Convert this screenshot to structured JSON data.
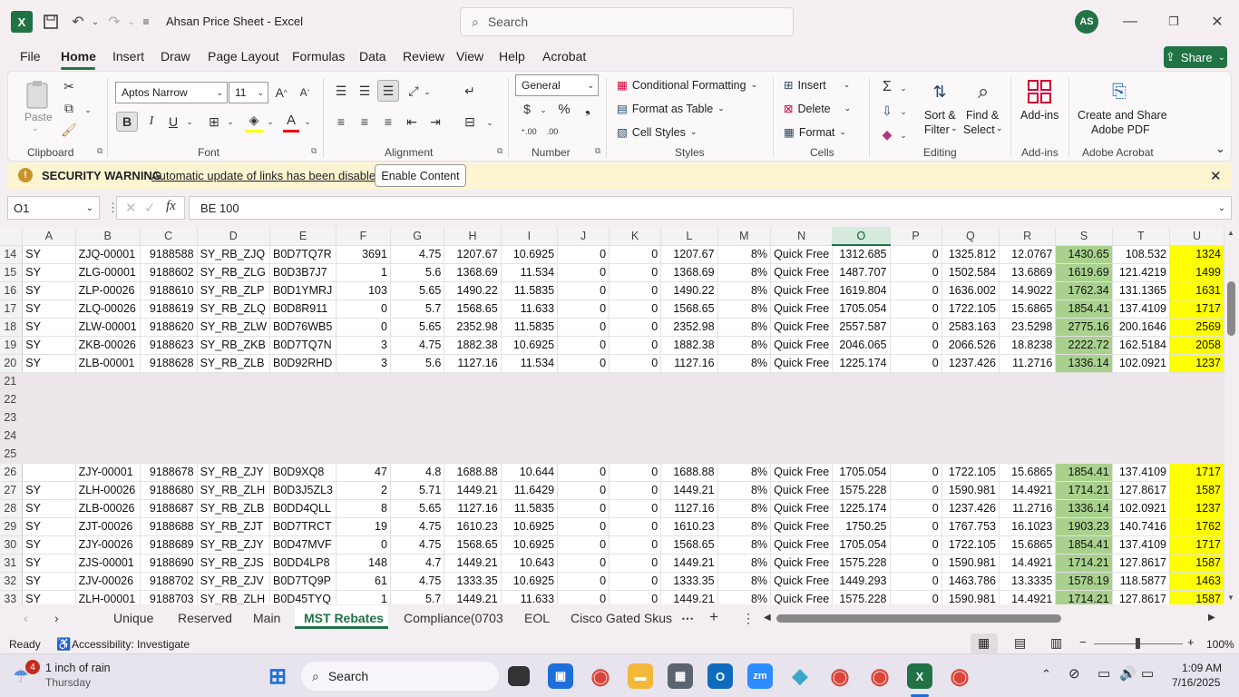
{
  "window": {
    "title": "Ahsan Price Sheet  -  Excel",
    "search_placeholder": "Search",
    "user_initials": "AS"
  },
  "menu": [
    "File",
    "Home",
    "Insert",
    "Draw",
    "Page Layout",
    "Formulas",
    "Data",
    "Review",
    "View",
    "Help",
    "Acrobat"
  ],
  "share_label": "Share",
  "ribbon": {
    "clipboard": {
      "paste": "Paste",
      "group": "Clipboard"
    },
    "font": {
      "name": "Aptos Narrow",
      "size": "11",
      "group": "Font"
    },
    "alignment": {
      "group": "Alignment"
    },
    "number": {
      "format": "General",
      "group": "Number"
    },
    "styles": {
      "conditional": "Conditional Formatting",
      "table": "Format as Table",
      "cell": "Cell Styles",
      "group": "Styles"
    },
    "cells": {
      "insert": "Insert",
      "delete": "Delete",
      "format": "Format",
      "group": "Cells"
    },
    "editing": {
      "sort1": "Sort &",
      "sort2": "Filter",
      "find1": "Find &",
      "find2": "Select",
      "group": "Editing"
    },
    "addins": {
      "label": "Add-ins",
      "group": "Add-ins"
    },
    "acrobat": {
      "l1": "Create and Share",
      "l2": "Adobe PDF",
      "group": "Adobe Acrobat"
    }
  },
  "warning": {
    "title": "SECURITY WARNING",
    "message": "Automatic update of links has been disabled",
    "button": "Enable Content"
  },
  "formula": {
    "namebox": "O1",
    "fx": "fx",
    "content": "BE 100"
  },
  "columns": [
    "A",
    "B",
    "C",
    "D",
    "E",
    "F",
    "G",
    "H",
    "I",
    "J",
    "K",
    "L",
    "M",
    "N",
    "O",
    "P",
    "Q",
    "R",
    "S",
    "T",
    "U"
  ],
  "selected_column": "O",
  "rows": [
    {
      "n": "14",
      "c": [
        "SY",
        "ZJQ-00001",
        "9188588",
        "SY_RB_ZJQ",
        "B0D7TQ7R",
        "3691",
        "4.75",
        "1207.67",
        "10.6925",
        "0",
        "0",
        "1207.67",
        "8%",
        "Quick Free",
        "1312.685",
        "0",
        "1325.812",
        "12.0767",
        "1430.65",
        "108.532",
        "1324"
      ]
    },
    {
      "n": "15",
      "c": [
        "SY",
        "ZLG-00001",
        "9188602",
        "SY_RB_ZLG",
        "B0D3B7J7",
        "1",
        "5.6",
        "1368.69",
        "11.534",
        "0",
        "0",
        "1368.69",
        "8%",
        "Quick Free",
        "1487.707",
        "0",
        "1502.584",
        "13.6869",
        "1619.69",
        "121.4219",
        "1499"
      ]
    },
    {
      "n": "16",
      "c": [
        "SY",
        "ZLP-00026",
        "9188610",
        "SY_RB_ZLP",
        "B0D1YMRJ",
        "103",
        "5.65",
        "1490.22",
        "11.5835",
        "0",
        "0",
        "1490.22",
        "8%",
        "Quick Free",
        "1619.804",
        "0",
        "1636.002",
        "14.9022",
        "1762.34",
        "131.1365",
        "1631"
      ]
    },
    {
      "n": "17",
      "c": [
        "SY",
        "ZLQ-00026",
        "9188619",
        "SY_RB_ZLQ",
        "B0D8R911",
        "0",
        "5.7",
        "1568.65",
        "11.633",
        "0",
        "0",
        "1568.65",
        "8%",
        "Quick Free",
        "1705.054",
        "0",
        "1722.105",
        "15.6865",
        "1854.41",
        "137.4109",
        "1717"
      ]
    },
    {
      "n": "18",
      "c": [
        "SY",
        "ZLW-00001",
        "9188620",
        "SY_RB_ZLW",
        "B0D76WB5",
        "0",
        "5.65",
        "2352.98",
        "11.5835",
        "0",
        "0",
        "2352.98",
        "8%",
        "Quick Free",
        "2557.587",
        "0",
        "2583.163",
        "23.5298",
        "2775.16",
        "200.1646",
        "2569"
      ]
    },
    {
      "n": "19",
      "c": [
        "SY",
        "ZKB-00026",
        "9188623",
        "SY_RB_ZKB",
        "B0D7TQ7N",
        "3",
        "4.75",
        "1882.38",
        "10.6925",
        "0",
        "0",
        "1882.38",
        "8%",
        "Quick Free",
        "2046.065",
        "0",
        "2066.526",
        "18.8238",
        "2222.72",
        "162.5184",
        "2058"
      ]
    },
    {
      "n": "20",
      "c": [
        "SY",
        "ZLB-00001",
        "9188628",
        "SY_RB_ZLB",
        "B0D92RHD",
        "3",
        "5.6",
        "1127.16",
        "11.534",
        "0",
        "0",
        "1127.16",
        "8%",
        "Quick Free",
        "1225.174",
        "0",
        "1237.426",
        "11.2716",
        "1336.14",
        "102.0921",
        "1237"
      ]
    },
    {
      "n": "21",
      "blank": true
    },
    {
      "n": "22",
      "blank": true
    },
    {
      "n": "23",
      "blank": true
    },
    {
      "n": "24",
      "blank": true
    },
    {
      "n": "25",
      "blank": true
    },
    {
      "n": "26",
      "c": [
        "",
        "ZJY-00001",
        "9188678",
        "SY_RB_ZJY",
        "B0D9XQ8",
        "47",
        "4.8",
        "1688.88",
        "10.644",
        "0",
        "0",
        "1688.88",
        "8%",
        "Quick Free",
        "1705.054",
        "0",
        "1722.105",
        "15.6865",
        "1854.41",
        "137.4109",
        "1717"
      ]
    },
    {
      "n": "27",
      "c": [
        "SY",
        "ZLH-00026",
        "9188680",
        "SY_RB_ZLH",
        "B0D3J5ZL3",
        "2",
        "5.71",
        "1449.21",
        "11.6429",
        "0",
        "0",
        "1449.21",
        "8%",
        "Quick Free",
        "1575.228",
        "0",
        "1590.981",
        "14.4921",
        "1714.21",
        "127.8617",
        "1587"
      ]
    },
    {
      "n": "28",
      "c": [
        "SY",
        "ZLB-00026",
        "9188687",
        "SY_RB_ZLB",
        "B0DD4QLL",
        "8",
        "5.65",
        "1127.16",
        "11.5835",
        "0",
        "0",
        "1127.16",
        "8%",
        "Quick Free",
        "1225.174",
        "0",
        "1237.426",
        "11.2716",
        "1336.14",
        "102.0921",
        "1237"
      ]
    },
    {
      "n": "29",
      "c": [
        "SY",
        "ZJT-00026",
        "9188688",
        "SY_RB_ZJT",
        "B0D7TRCT",
        "19",
        "4.75",
        "1610.23",
        "10.6925",
        "0",
        "0",
        "1610.23",
        "8%",
        "Quick Free",
        "1750.25",
        "0",
        "1767.753",
        "16.1023",
        "1903.23",
        "140.7416",
        "1762"
      ]
    },
    {
      "n": "30",
      "c": [
        "SY",
        "ZJY-00026",
        "9188689",
        "SY_RB_ZJY",
        "B0D47MVF",
        "0",
        "4.75",
        "1568.65",
        "10.6925",
        "0",
        "0",
        "1568.65",
        "8%",
        "Quick Free",
        "1705.054",
        "0",
        "1722.105",
        "15.6865",
        "1854.41",
        "137.4109",
        "1717"
      ]
    },
    {
      "n": "31",
      "c": [
        "SY",
        "ZJS-00001",
        "9188690",
        "SY_RB_ZJS",
        "B0DD4LP8",
        "148",
        "4.7",
        "1449.21",
        "10.643",
        "0",
        "0",
        "1449.21",
        "8%",
        "Quick Free",
        "1575.228",
        "0",
        "1590.981",
        "14.4921",
        "1714.21",
        "127.8617",
        "1587"
      ]
    },
    {
      "n": "32",
      "c": [
        "SY",
        "ZJV-00026",
        "9188702",
        "SY_RB_ZJV",
        "B0D7TQ9P",
        "61",
        "4.75",
        "1333.35",
        "10.6925",
        "0",
        "0",
        "1333.35",
        "8%",
        "Quick Free",
        "1449.293",
        "0",
        "1463.786",
        "13.3335",
        "1578.19",
        "118.5877",
        "1463"
      ]
    },
    {
      "n": "33",
      "c": [
        "SY",
        "ZLH-00001",
        "9188703",
        "SY_RB_ZLH",
        "B0D45TYQ",
        "1",
        "5.7",
        "1449.21",
        "11.633",
        "0",
        "0",
        "1449.21",
        "8%",
        "Quick Free",
        "1575.228",
        "0",
        "1590.981",
        "14.4921",
        "1714.21",
        "127.8617",
        "1587"
      ]
    }
  ],
  "sheets": [
    "Unique",
    "Reserved",
    "Main",
    "MST Rebates",
    "Compliance(0703",
    "EOL",
    "Cisco Gated Skus"
  ],
  "active_sheet": "MST Rebates",
  "status": {
    "ready": "Ready",
    "accessibility": "Accessibility: Investigate",
    "zoom": "100%"
  },
  "taskbar": {
    "weather": "1 inch of rain",
    "day": "Thursday",
    "badge": "4",
    "search": "Search",
    "time": "1:09 AM",
    "date": "7/16/2025"
  }
}
